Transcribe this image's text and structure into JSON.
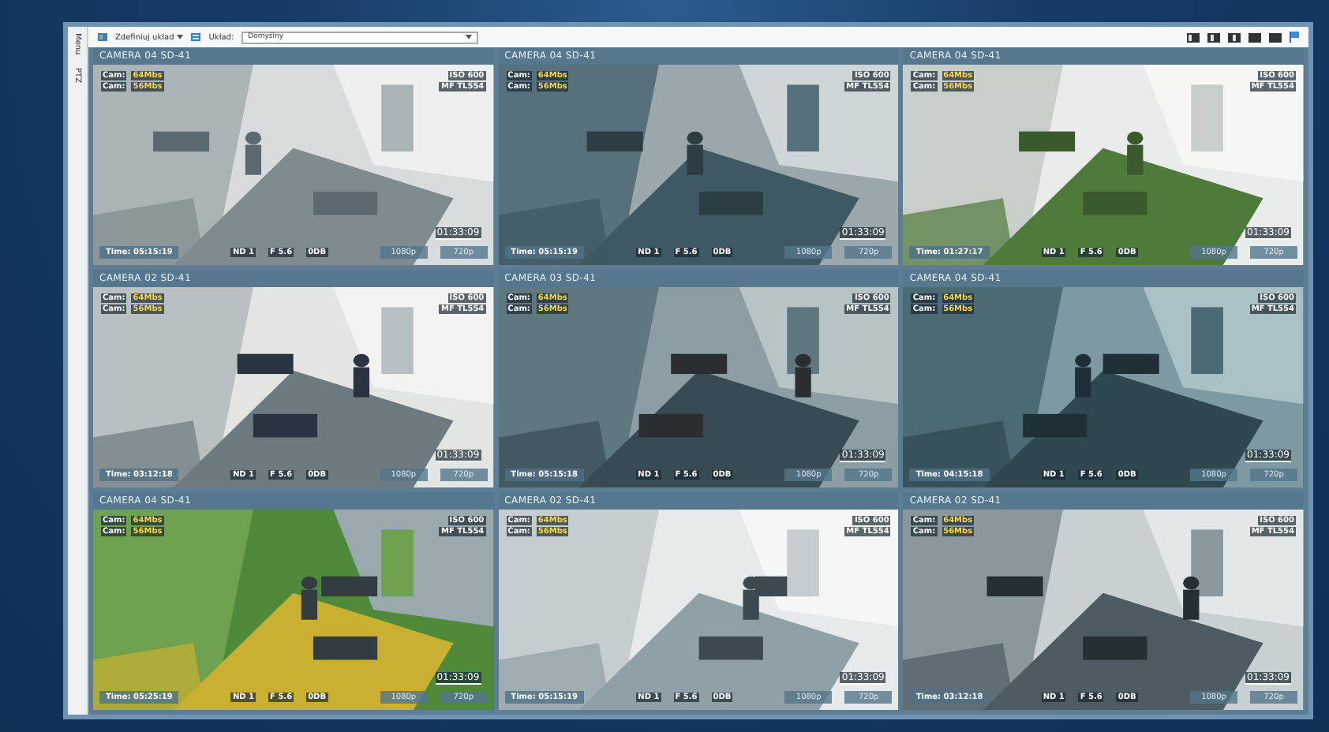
{
  "sidebar": {
    "tabs": [
      {
        "label": "Menu"
      },
      {
        "label": "PTZ"
      }
    ]
  },
  "toolbar": {
    "define_layout": "Zdefiniuj układ",
    "layout_label": "Układ:",
    "layout_value": "Domyślny"
  },
  "cameras": [
    {
      "title": "CAMERA 04 SD-41",
      "bitrates": [
        {
          "label": "Cam:",
          "value": "64Mbs"
        },
        {
          "label": "Cam:",
          "value": "56Mbs"
        }
      ],
      "iso": "ISO 600",
      "lens": "MF TL554",
      "time": "Time: 05:15:19",
      "nd": "ND 1",
      "f": "F 5.6",
      "gain": "0DB",
      "res_hi": "1080p",
      "res_lo": "720p",
      "clock": "01:33:09"
    },
    {
      "title": "CAMERA 04 SD-41",
      "bitrates": [
        {
          "label": "Cam:",
          "value": "64Mbs"
        },
        {
          "label": "Cam:",
          "value": "56Mbs"
        }
      ],
      "iso": "ISO 600",
      "lens": "MF TL554",
      "time": "Time: 05:15:19",
      "nd": "ND 1",
      "f": "F 5.6",
      "gain": "0DB",
      "res_hi": "1080p",
      "res_lo": "720p",
      "clock": "01:33:09"
    },
    {
      "title": "CAMERA 04 SD-41",
      "bitrates": [
        {
          "label": "Cam:",
          "value": "64Mbs"
        },
        {
          "label": "Cam:",
          "value": "56Mbs"
        }
      ],
      "iso": "ISO 600",
      "lens": "MF TL554",
      "time": "Time: 01:27:17",
      "nd": "ND 1",
      "f": "F 5.6",
      "gain": "0DB",
      "res_hi": "1080p",
      "res_lo": "720p",
      "clock": "01:33:09"
    },
    {
      "title": "CAMERA 02 SD-41",
      "bitrates": [
        {
          "label": "Cam:",
          "value": "64Mbs"
        },
        {
          "label": "Cam:",
          "value": "56Mbs"
        }
      ],
      "iso": "ISO 600",
      "lens": "MF TL554",
      "time": "Time: 03:12:18",
      "nd": "ND 1",
      "f": "F 5.6",
      "gain": "0DB",
      "res_hi": "1080p",
      "res_lo": "720p",
      "clock": "01:33:09"
    },
    {
      "title": "CAMERA 03 SD-41",
      "bitrates": [
        {
          "label": "Cam:",
          "value": "64Mbs"
        },
        {
          "label": "Cam:",
          "value": "56Mbs"
        }
      ],
      "iso": "ISO 600",
      "lens": "MF TL554",
      "time": "Time: 05:15:18",
      "nd": "ND 1",
      "f": "F 5.6",
      "gain": "0DB",
      "res_hi": "1080p",
      "res_lo": "720p",
      "clock": "01:33:09"
    },
    {
      "title": "CAMERA 04 SD-41",
      "bitrates": [
        {
          "label": "Cam:",
          "value": "64Mbs"
        },
        {
          "label": "Cam:",
          "value": "56Mbs"
        }
      ],
      "iso": "ISO 600",
      "lens": "MF TL554",
      "time": "Time: 04:15:18",
      "nd": "ND 1",
      "f": "F 5.6",
      "gain": "0DB",
      "res_hi": "1080p",
      "res_lo": "720p",
      "clock": "01:33:09"
    },
    {
      "title": "CAMERA 04 SD-41",
      "bitrates": [
        {
          "label": "Cam:",
          "value": "64Mbs"
        },
        {
          "label": "Cam:",
          "value": "56Mbs"
        }
      ],
      "iso": "ISO 600",
      "lens": "MF TL554",
      "time": "Time: 05:25:19",
      "nd": "ND 1",
      "f": "F 5.6",
      "gain": "0DB",
      "res_hi": "1080p",
      "res_lo": "720p",
      "clock": "01:33:09"
    },
    {
      "title": "CAMERA 02 SD-41",
      "bitrates": [
        {
          "label": "Cam:",
          "value": "64Mbs"
        },
        {
          "label": "Cam:",
          "value": "56Mbs"
        }
      ],
      "iso": "ISO 600",
      "lens": "MF TL554",
      "time": "Time: 05:15:19",
      "nd": "ND 1",
      "f": "F 5.6",
      "gain": "0DB",
      "res_hi": "1080p",
      "res_lo": "720p",
      "clock": "01:33:09"
    },
    {
      "title": "CAMERA 02 SD-41",
      "bitrates": [
        {
          "label": "Cam:",
          "value": "64Mbs"
        },
        {
          "label": "Cam:",
          "value": "56Mbs"
        }
      ],
      "iso": "ISO 600",
      "lens": "MF TL554",
      "time": "Time: 03:12:18",
      "nd": "ND 1",
      "f": "F 5.6",
      "gain": "0DB",
      "res_hi": "1080p",
      "res_lo": "720p",
      "clock": "01:33:09"
    }
  ]
}
